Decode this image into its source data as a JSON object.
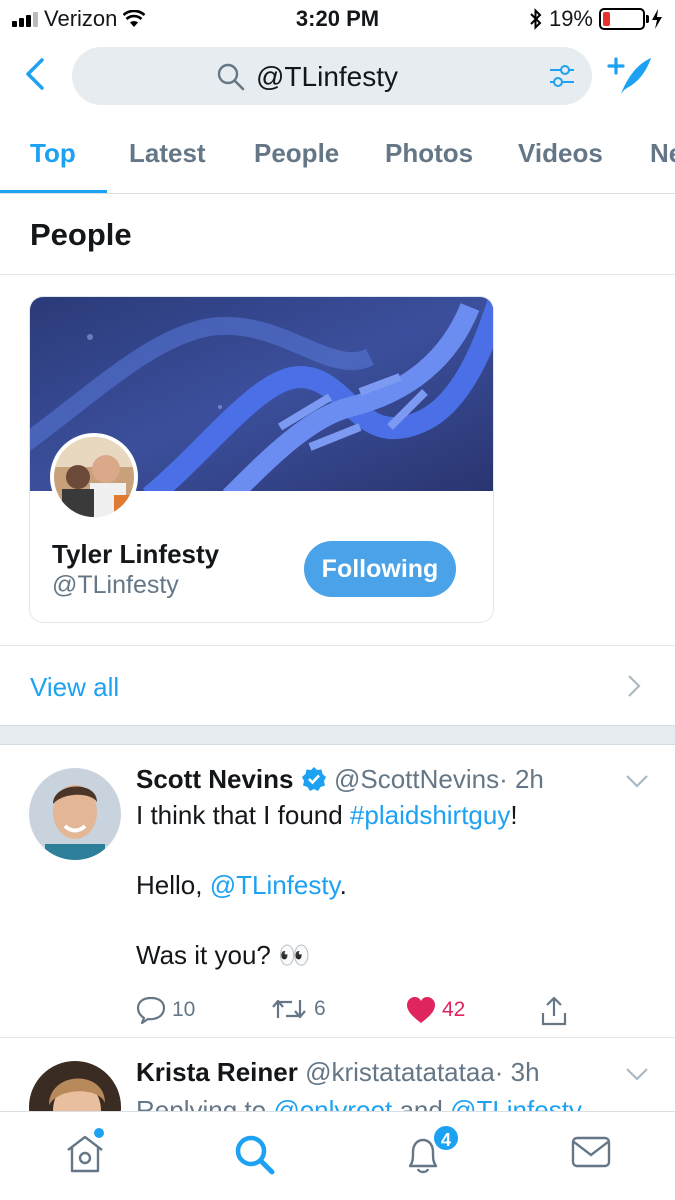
{
  "status_bar": {
    "carrier": "Verizon",
    "time": "3:20 PM",
    "battery_percent": "19%",
    "battery_level": 0.19
  },
  "search": {
    "query": "@TLinfesty"
  },
  "tabs": [
    {
      "label": "Top",
      "active": true
    },
    {
      "label": "Latest"
    },
    {
      "label": "People"
    },
    {
      "label": "Photos"
    },
    {
      "label": "Videos"
    },
    {
      "label": "News"
    }
  ],
  "people_section": {
    "title": "People",
    "card": {
      "name": "Tyler Linfesty",
      "handle": "@TLinfesty",
      "follow_label": "Following"
    },
    "view_all": "View all"
  },
  "tweets": [
    {
      "name": "Scott Nevins",
      "verified": true,
      "handle": "@ScottNevins",
      "time": "· 2h",
      "line1_text": "I think that I found ",
      "line1_hashtag": "#plaidshirtguy",
      "line1_end": "!",
      "line2_text": "Hello, ",
      "line2_mention": "@TLinfesty",
      "line2_end": ".",
      "line3_text": "Was it you? 👀",
      "replies": "10",
      "retweets": "6",
      "likes": "42"
    },
    {
      "name": "Krista Reiner",
      "handle": "@kristatatatataa",
      "time": "· 3h",
      "reply_prefix": "Replying to ",
      "reply_user1": "@onlyroot",
      "reply_and": " and ",
      "reply_user2": "@TLinfesty"
    }
  ],
  "tab_bar": {
    "notifications_badge": "4"
  },
  "colors": {
    "accent": "#1da1f2",
    "like": "#e0245e",
    "following_button": "#4aa3e8"
  }
}
